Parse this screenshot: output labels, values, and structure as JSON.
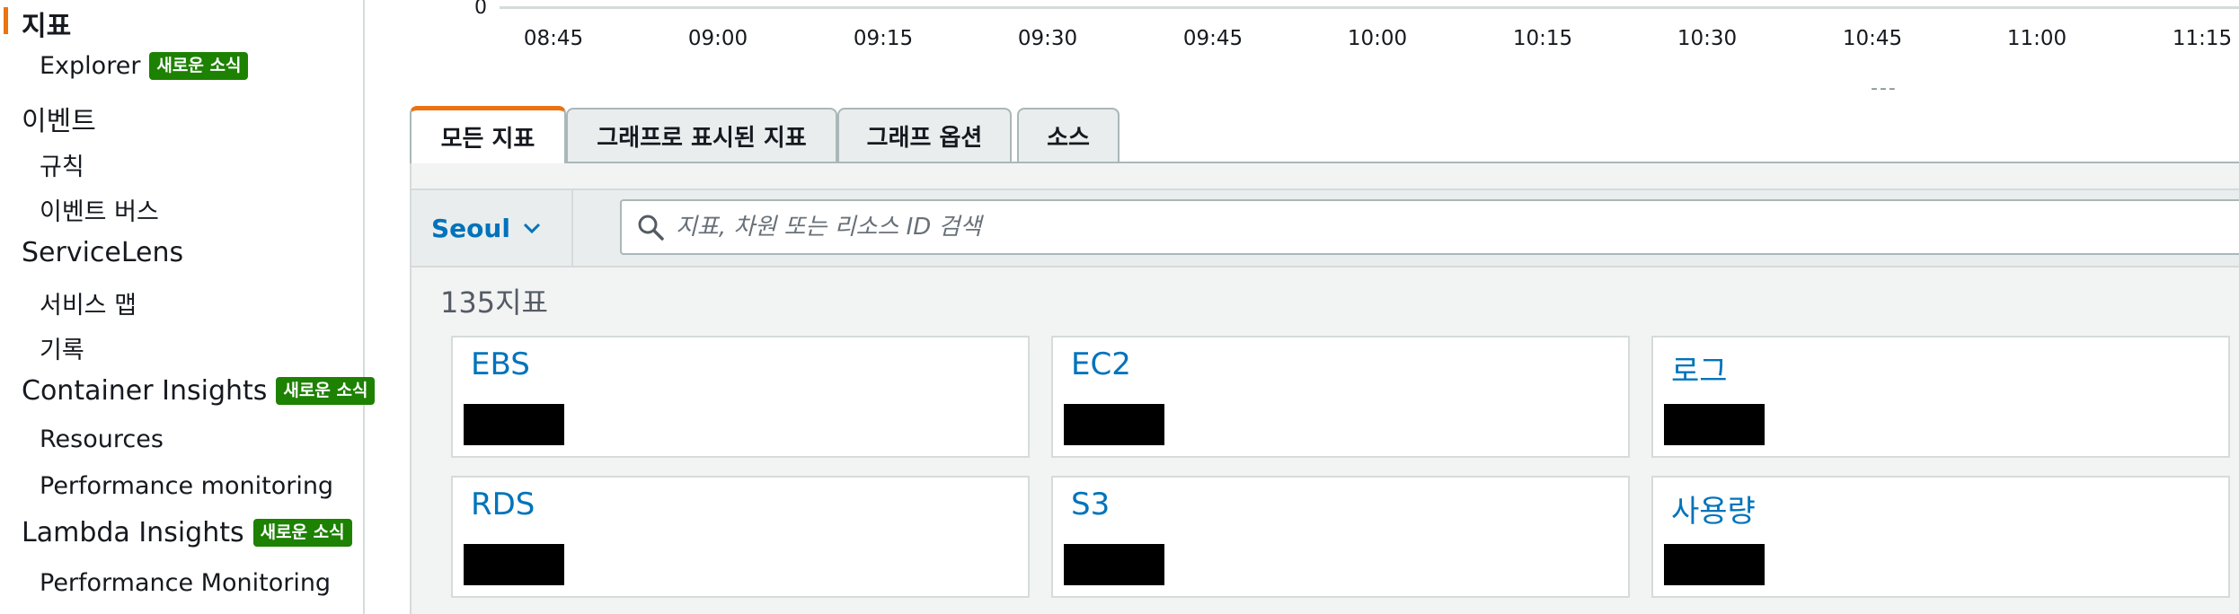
{
  "sidebar": {
    "items": [
      {
        "label": "지표",
        "level": 1,
        "active": true
      },
      {
        "label": "Explorer",
        "level": 2,
        "badge": "새로운 소식"
      },
      {
        "label": "이벤트",
        "level": 1
      },
      {
        "label": "규칙",
        "level": 2
      },
      {
        "label": "이벤트 버스",
        "level": 2
      },
      {
        "label": "ServiceLens",
        "level": 1
      },
      {
        "label": "서비스 맵",
        "level": 2
      },
      {
        "label": "기록",
        "level": 2
      },
      {
        "label": "Container Insights",
        "level": 1,
        "badge": "새로운 소식"
      },
      {
        "label": "Resources",
        "level": 2
      },
      {
        "label": "Performance monitoring",
        "level": 2
      },
      {
        "label": "Lambda Insights",
        "level": 1,
        "badge": "새로운 소식"
      },
      {
        "label": "Performance Monitoring",
        "level": 2
      }
    ]
  },
  "axis": {
    "zero_label": "0",
    "ticks": [
      "08:45",
      "09:00",
      "09:15",
      "09:30",
      "09:45",
      "10:00",
      "10:15",
      "10:30",
      "10:45",
      "11:00",
      "11:15"
    ],
    "grip": "---"
  },
  "tabs": [
    {
      "label": "모든 지표",
      "active": true
    },
    {
      "label": "그래프로 표시된 지표"
    },
    {
      "label": "그래프 옵션"
    },
    {
      "label": "소스"
    }
  ],
  "filter": {
    "region": "Seoul",
    "search_placeholder": "지표, 차원 또는 리소스 ID 검색"
  },
  "metrics": {
    "count_label": "135지표",
    "cards": [
      {
        "title": "EBS"
      },
      {
        "title": "EC2"
      },
      {
        "title": "로그"
      },
      {
        "title": "RDS"
      },
      {
        "title": "S3"
      },
      {
        "title": "사용량"
      }
    ]
  },
  "colors": {
    "link": "#0073bb",
    "accent": "#ec7211",
    "badge": "#1d8102"
  }
}
